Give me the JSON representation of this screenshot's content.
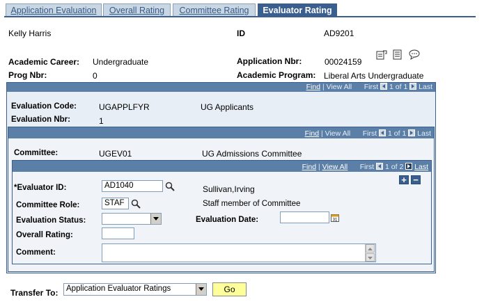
{
  "tabs": [
    "Application Evaluation",
    "Overall Rating",
    "Committee Rating",
    "Evaluator Rating"
  ],
  "applicant": {
    "name": "Kelly Harris",
    "id_label": "ID",
    "id_value": "AD9201"
  },
  "career": {
    "label": "Academic Career:",
    "value": "Undergraduate"
  },
  "app_nbr": {
    "label": "Application Nbr:",
    "value": "00024159"
  },
  "prog_nbr": {
    "label": "Prog Nbr:",
    "value": "0"
  },
  "program": {
    "label": "Academic Program:",
    "value": "Liberal Arts Undergraduate"
  },
  "icons": [
    "notepad-icon",
    "checklist-icon",
    "comment-bubble-icon"
  ],
  "nav1": {
    "find": "Find",
    "sep": "|",
    "view_all": "View All",
    "first": "First",
    "range": "1 of 1",
    "last": "Last"
  },
  "evaluation": {
    "code_label": "Evaluation Code:",
    "code": "UGAPPLFYR",
    "code_desc": "UG Applicants",
    "nbr_label": "Evaluation Nbr:",
    "nbr": "1"
  },
  "nav2": {
    "find": "Find",
    "sep": "|",
    "view_all": "View All",
    "first": "First",
    "range": "1 of 1",
    "last": "Last"
  },
  "committee": {
    "label": "Committee:",
    "value": "UGEV01",
    "desc": "UG Admissions Committee"
  },
  "nav3": {
    "find": "Find",
    "sep": "|",
    "view_all": "View All",
    "first": "First",
    "range": "1 of 2",
    "last": "Last"
  },
  "evaluator": {
    "id_label": "*Evaluator ID:",
    "id_value": "AD1040",
    "id_name": "Sullivan,Irving",
    "role_label": "Committee Role:",
    "role_value": "STAF",
    "role_desc": "Staff member of Committee",
    "status_label": "Evaluation Status:",
    "status_value": "",
    "date_label": "Evaluation Date:",
    "date_value": "",
    "rating_label": "Overall Rating:",
    "rating_value": "",
    "comment_label": "Comment:",
    "comment_value": ""
  },
  "transfer": {
    "label": "Transfer To:",
    "value": "Application Evaluator Ratings",
    "go": "Go"
  }
}
